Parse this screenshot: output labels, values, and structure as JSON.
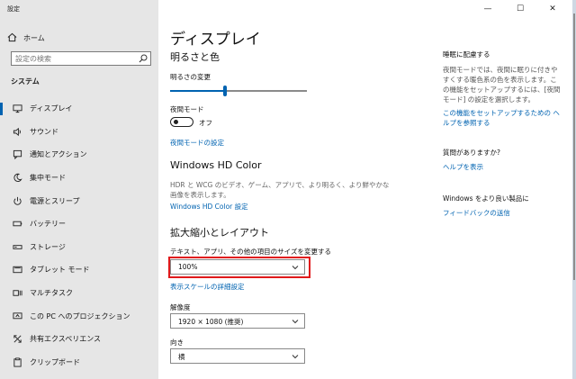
{
  "window": {
    "title": "設定",
    "controls": [
      "—",
      "☐",
      "✕"
    ]
  },
  "sidebar": {
    "home_label": "ホーム",
    "search_placeholder": "設定の検索",
    "section": "システム",
    "items": [
      {
        "label": "ディスプレイ",
        "icon": "monitor-icon",
        "active": true
      },
      {
        "label": "サウンド",
        "icon": "speaker-icon"
      },
      {
        "label": "通知とアクション",
        "icon": "notification-icon"
      },
      {
        "label": "集中モード",
        "icon": "moon-icon"
      },
      {
        "label": "電源とスリープ",
        "icon": "power-icon"
      },
      {
        "label": "バッテリー",
        "icon": "battery-icon"
      },
      {
        "label": "ストレージ",
        "icon": "storage-icon"
      },
      {
        "label": "タブレット モード",
        "icon": "tablet-icon"
      },
      {
        "label": "マルチタスク",
        "icon": "multitask-icon"
      },
      {
        "label": "この PC へのプロジェクション",
        "icon": "projection-icon"
      },
      {
        "label": "共有エクスペリエンス",
        "icon": "shared-icon"
      },
      {
        "label": "クリップボード",
        "icon": "clipboard-icon"
      }
    ]
  },
  "main": {
    "title": "ディスプレイ",
    "brightness": {
      "heading": "明るさと色",
      "label": "明るさの変更",
      "level_percent": 40
    },
    "night": {
      "label": "夜間モード",
      "state": "オフ",
      "settings_link": "夜間モードの設定"
    },
    "hdr": {
      "heading": "Windows HD Color",
      "desc": "HDR と WCG のビデオ、ゲーム、アプリで、より明るく、より鮮やかな画像を表示します。",
      "link": "Windows HD Color 設定"
    },
    "scale": {
      "heading": "拡大縮小とレイアウト",
      "label": "テキスト、アプリ、その他の項目のサイズを変更する",
      "value": "100%",
      "advanced_link": "表示スケールの詳細設定"
    },
    "resolution": {
      "label": "解像度",
      "value": "1920 × 1080 (推奨)"
    },
    "orientation": {
      "label": "向き",
      "value": "横"
    }
  },
  "right": {
    "sleep_heading": "睡眠に配慮する",
    "sleep_text": "夜間モードでは、夜間に眠りに付きやすくする暖色系の色を表示します。この機能をセットアップするには、[夜間モード] の設定を選択します。",
    "sleep_link": "この機能をセットアップするための ヘルプを参照する",
    "question_heading": "質問がありますか?",
    "help_link": "ヘルプを表示",
    "improve_heading": "Windows をより良い製品に",
    "feedback_link": "フィードバックの送信"
  },
  "colors": {
    "accent": "#0063b1",
    "highlight": "#e0191b",
    "sidebar_bg": "#e6e6e6"
  }
}
